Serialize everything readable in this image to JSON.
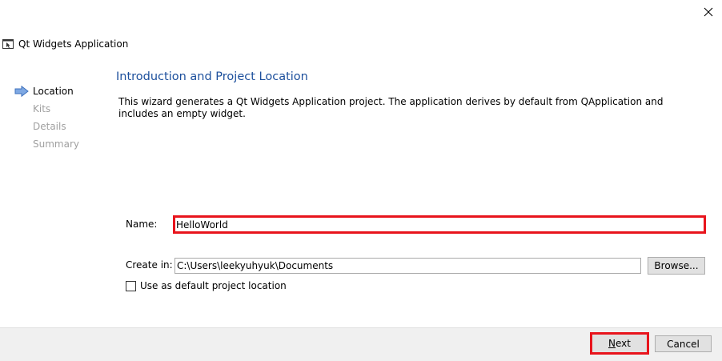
{
  "window": {
    "title": "Qt Widgets Application",
    "close_icon": "close-icon",
    "app_icon": "qt-widgets-app-icon"
  },
  "steps": [
    {
      "label": "Location",
      "active": true
    },
    {
      "label": "Kits",
      "active": false
    },
    {
      "label": "Details",
      "active": false
    },
    {
      "label": "Summary",
      "active": false
    }
  ],
  "page": {
    "heading": "Introduction and Project Location",
    "description": "This wizard generates a Qt Widgets Application project. The application derives by default from QApplication and includes an empty widget."
  },
  "form": {
    "name_label": "Name:",
    "name_value": "HelloWorld",
    "create_in_label": "Create in:",
    "create_in_value": "C:\\Users\\leekyuhyuk\\Documents",
    "browse_label": "Browse...",
    "default_location_label": "Use as default project location",
    "default_location_checked": false
  },
  "footer": {
    "next_mnemonic": "N",
    "next_rest": "ext",
    "cancel_label": "Cancel"
  },
  "colors": {
    "heading": "#1c4f9c",
    "highlight": "#e8141c",
    "step_arrow": "#5b8fd6"
  }
}
